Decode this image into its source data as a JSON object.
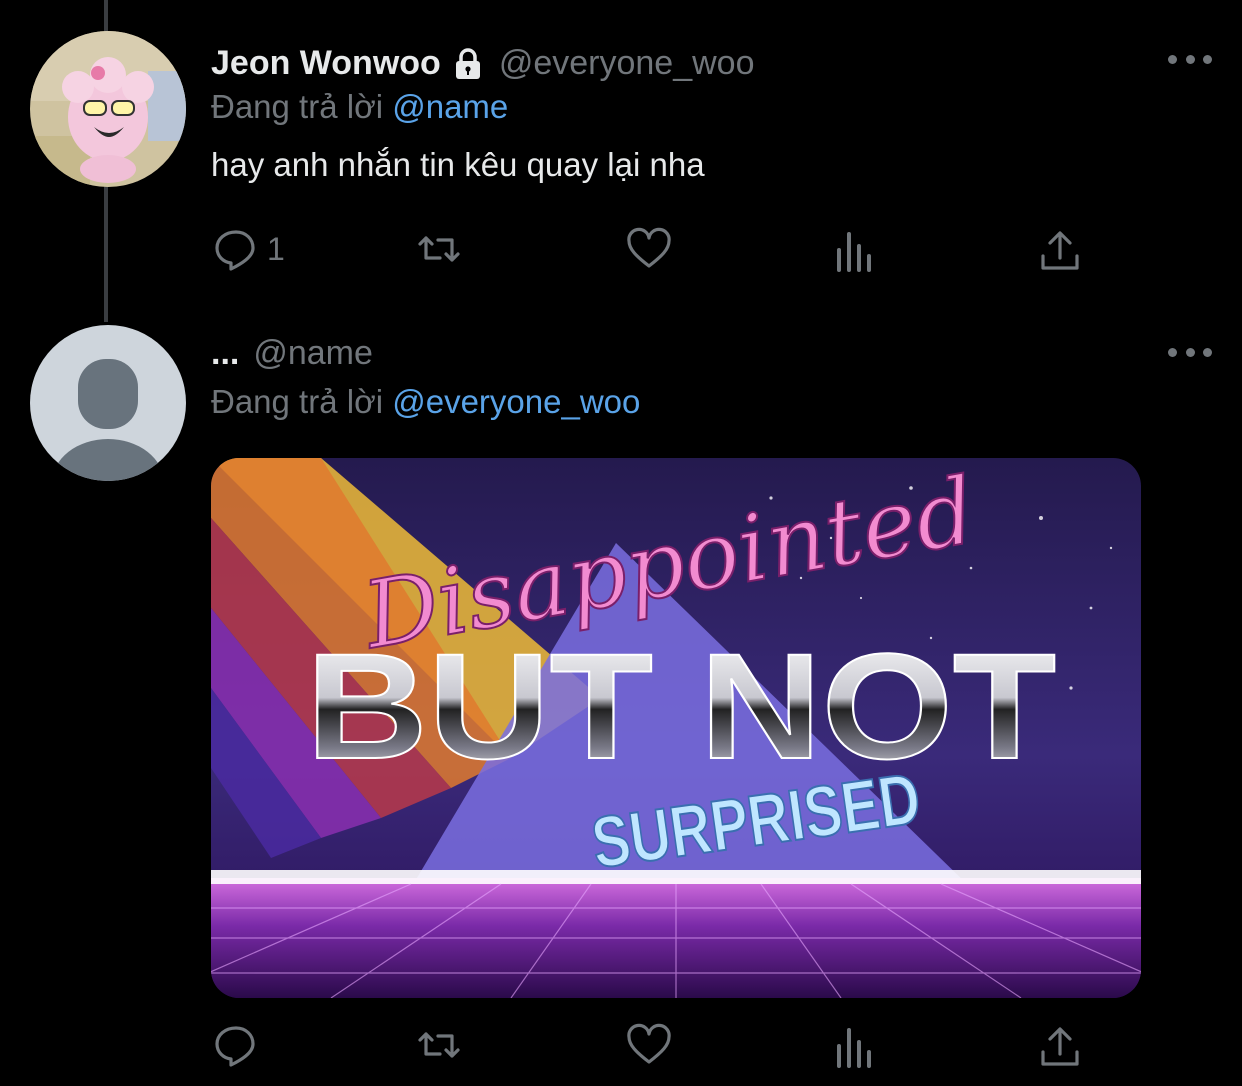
{
  "tweet1": {
    "display_name": "Jeon Wonwoo",
    "handle": "@everyone_woo",
    "reply_prefix": "Đang trả lời",
    "reply_mention": "@name",
    "text": "hay anh nhắn tin kêu quay lại nha",
    "reply_count": "1"
  },
  "tweet2": {
    "display_name": "...",
    "handle": "@name",
    "reply_prefix": "Đang trả lời",
    "reply_mention": "@everyone_woo",
    "media": {
      "line1": "Disappointed",
      "line2": "BUT NOT",
      "line3": "SURPRISED"
    }
  },
  "colors": {
    "background": "#000000",
    "text": "#e7e9ea",
    "muted": "#71767b",
    "link": "#5aa3e8",
    "thread_line": "#3a3d41"
  },
  "icons": [
    "lock-icon",
    "more-icon",
    "reply-icon",
    "retweet-icon",
    "like-icon",
    "views-icon",
    "share-icon"
  ]
}
